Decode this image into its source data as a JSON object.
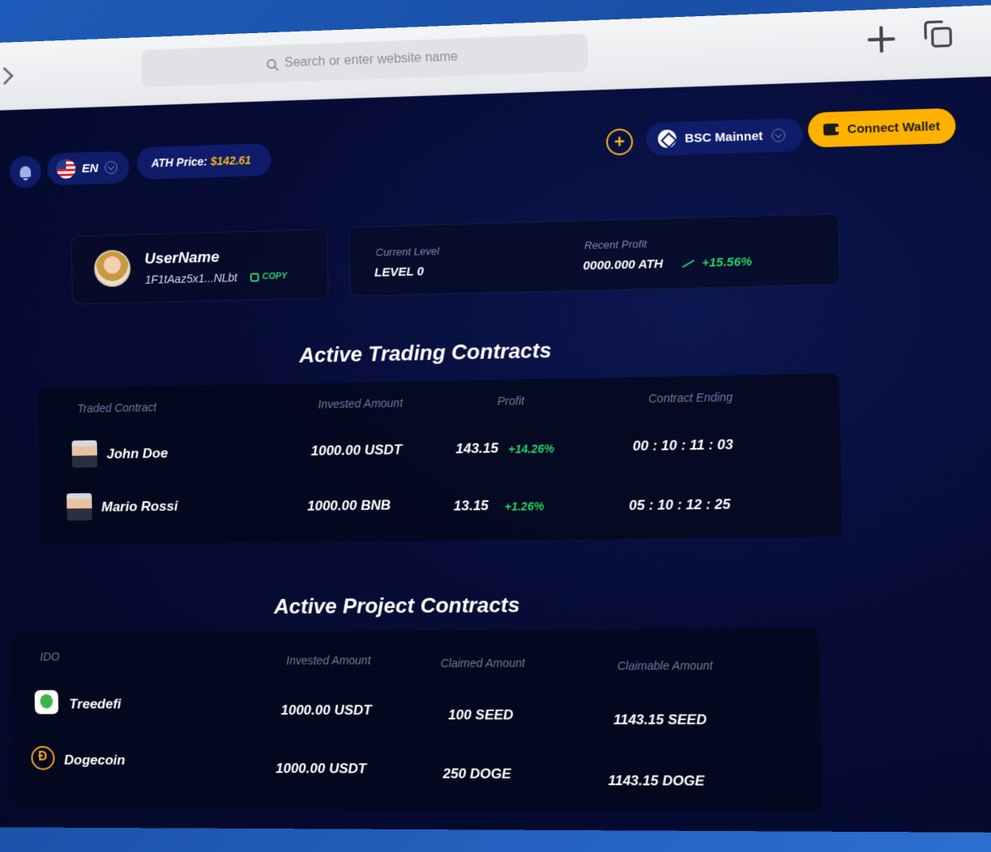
{
  "browser": {
    "search_placeholder": "Search or enter website name"
  },
  "header": {
    "language": "EN",
    "ath_label": "ATH Price:",
    "ath_value": "$142.61",
    "network": "BSC Mainnet",
    "connect_label": "Connect Wallet"
  },
  "profile": {
    "username": "UserName",
    "address": "1F1tAaz5x1...NLbt",
    "copy_label": "COPY",
    "current_level_label": "Current Level",
    "current_level_value": "LEVEL 0",
    "recent_profit_label": "Recent Profit",
    "recent_profit_value": "0000.000 ATH",
    "recent_profit_change": "+15.56%"
  },
  "trading": {
    "title": "Active Trading Contracts",
    "columns": [
      "Traded Contract",
      "Invested Amount",
      "Profit",
      "Contract Ending"
    ],
    "rows": [
      {
        "name": "John Doe",
        "invested": "1000.00 USDT",
        "profit": "143.15",
        "change": "+14.26%",
        "ending": "00 : 10 : 11 : 03"
      },
      {
        "name": "Mario Rossi",
        "invested": "1000.00 BNB",
        "profit": "13.15",
        "change": "+1.26%",
        "ending": "05 : 10 : 12 : 25"
      }
    ]
  },
  "projects": {
    "title": "Active Project Contracts",
    "columns": [
      "IDO",
      "Invested Amount",
      "Claimed Amount",
      "Claimable Amount"
    ],
    "rows": [
      {
        "name": "Treedefi",
        "invested": "1000.00 USDT",
        "claimed": "100 SEED",
        "claimable": "1143.15 SEED"
      },
      {
        "name": "Dogecoin",
        "invested": "1000.00 USDT",
        "claimed": "250 DOGE",
        "claimable": "1143.15 DOGE"
      }
    ]
  },
  "colors": {
    "accent": "#ffb200",
    "positive": "#25d366",
    "background": "#060c35"
  }
}
